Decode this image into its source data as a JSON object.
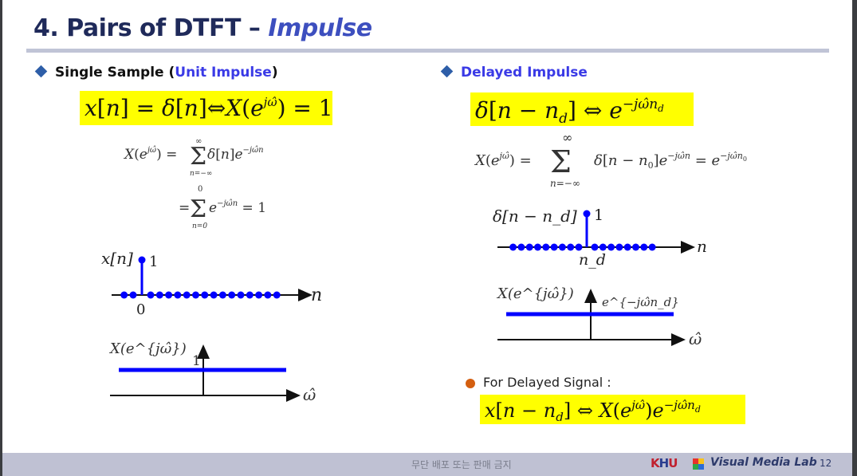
{
  "slide": {
    "title_main": "4. Pairs of DTFT – ",
    "title_accent": "Impulse",
    "page_number": "12"
  },
  "left": {
    "bullet_prefix": "Single Sample (",
    "bullet_highlight": "Unit Impulse",
    "bullet_suffix": ")",
    "pair_formula": "x[n] = δ[n] ⇔ X(e^{jŵ}) = 1",
    "derivation": {
      "line1_lhs": "X(e",
      "line1_sup": "jω̂",
      "line1_mid": ") = ",
      "line1_term": "δ[n]e",
      "line1_term_sup": "−jω̂n",
      "line1_upper": "∞",
      "line1_lower": "n=−∞",
      "line2_eq": "= ",
      "line2_term": "e",
      "line2_term_sup": "−jω̂n",
      "line2_rhs": " = 1",
      "line2_upper": "0",
      "line2_lower": "n=0"
    },
    "stem_plot": {
      "ylabel": "x[n]",
      "value_label": "1",
      "origin_label": "0",
      "xlabel": "n",
      "samples_left_of_impulse": 2,
      "samples_right_of_impulse": 15,
      "impulse_value": 1
    },
    "spectrum_plot": {
      "ylabel": "X(e^{jω̂})",
      "level_label": "1",
      "xlabel": "ω̂",
      "magnitude": 1
    }
  },
  "right": {
    "bullet_label": "Delayed Impulse",
    "pair_formula": "δ[n − n_d] ⇔ e^{−jω̂n_d}",
    "derivation": {
      "lhs": "X(e",
      "lhs_sup": "jω̂",
      "mid": ") = ",
      "term": "δ[n − n",
      "term_sub": "0",
      "term_close": "]e",
      "term_sup": "−jω̂n",
      "rhs": " = e",
      "rhs_sup": "−jω̂n₀",
      "upper": "∞",
      "lower": "n=−∞"
    },
    "stem_plot": {
      "ylabel": "δ[n − n_d]",
      "value_label": "1",
      "delay_label": "n_d",
      "xlabel": "n",
      "samples_left_of_impulse": 9,
      "samples_right_of_impulse": 8,
      "impulse_value": 1
    },
    "spectrum_plot": {
      "ylabel": "X(e^{jω̂})",
      "level_label": "e^{−jω̂n_d}",
      "xlabel": "ω̂"
    },
    "note_label": "For Delayed Signal :",
    "note_formula": "x[n − n_d] ⇔ X(e^{jω̂})e^{−jω̂n_d}"
  },
  "footer": {
    "copyright": "무단 배포 또는 판매 금지",
    "khu_k": "K",
    "khu_h": "H",
    "khu_u": "U",
    "lab_name": "Visual Media Lab",
    "logo_colors": [
      "#e8322b",
      "#f7c21b",
      "#2ea84a",
      "#2b6cd6"
    ]
  },
  "colors": {
    "title": "#1f2a5a",
    "title_accent": "#3d4fbf",
    "highlight": "#ffff00",
    "stem_blue": "#0000ff",
    "bullet_diamond": "#2e5ea8",
    "note_dot": "#d45f10",
    "footer_bg": "#bfc1d3"
  }
}
